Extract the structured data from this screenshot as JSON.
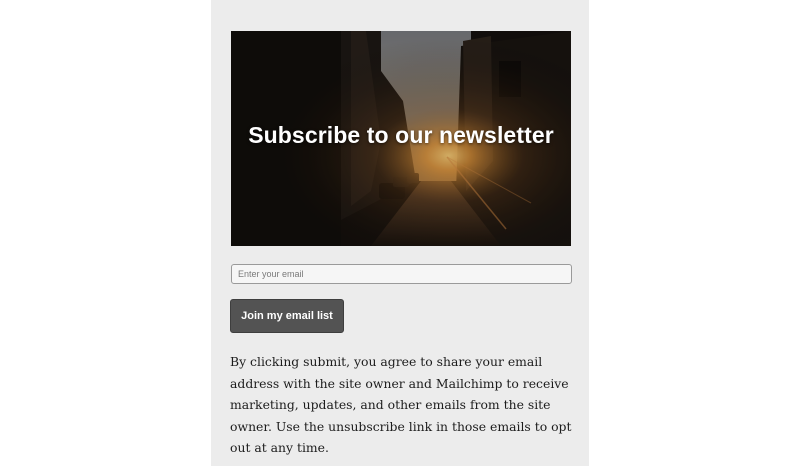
{
  "hero": {
    "title": "Subscribe to our newsletter",
    "image": "sunset-city-street-photo"
  },
  "form": {
    "email_placeholder": "Enter your email",
    "email_value": "",
    "submit_label": "Join my email list"
  },
  "disclaimer": {
    "text": "By clicking submit, you agree to share your email address with the site owner and Mailchimp to receive marketing, updates, and other emails from the site owner. Use the unsubscribe link in those emails to opt out at any time."
  },
  "colors": {
    "panel_background": "#ececec",
    "button_background": "#535353",
    "button_text": "#ffffff"
  }
}
